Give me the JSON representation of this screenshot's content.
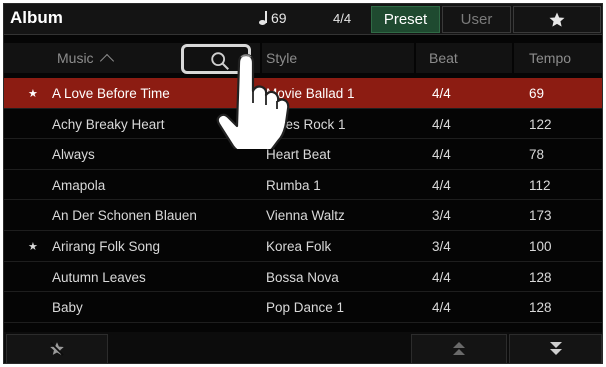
{
  "header": {
    "title": "Album",
    "tempo_value": "69",
    "time_signature": "4/4",
    "tabs": [
      {
        "label": "Preset",
        "active": true
      },
      {
        "label": "User",
        "active": false
      }
    ],
    "favorites_icon": "star-icon"
  },
  "columns": {
    "music": "Music",
    "style": "Style",
    "beat": "Beat",
    "tempo": "Tempo"
  },
  "search_icon": "search-icon",
  "rows": [
    {
      "fav": true,
      "name": "A Love Before Time",
      "style": "Movie Ballad 1",
      "beat": "4/4",
      "tempo": "69",
      "selected": true
    },
    {
      "fav": false,
      "name": "Achy Breaky Heart",
      "style": "Blues Rock 1",
      "beat": "4/4",
      "tempo": "122",
      "selected": false
    },
    {
      "fav": false,
      "name": "Always",
      "style": "Heart Beat",
      "beat": "4/4",
      "tempo": "78",
      "selected": false
    },
    {
      "fav": false,
      "name": "Amapola",
      "style": "Rumba 1",
      "beat": "4/4",
      "tempo": "112",
      "selected": false
    },
    {
      "fav": false,
      "name": "An Der Schonen Blauen",
      "style": "Vienna Waltz",
      "beat": "3/4",
      "tempo": "173",
      "selected": false
    },
    {
      "fav": true,
      "name": "Arirang Folk Song",
      "style": "Korea Folk",
      "beat": "3/4",
      "tempo": "100",
      "selected": false
    },
    {
      "fav": false,
      "name": "Autumn Leaves",
      "style": "Bossa Nova",
      "beat": "4/4",
      "tempo": "128",
      "selected": false
    },
    {
      "fav": false,
      "name": "Baby",
      "style": "Pop Dance 1",
      "beat": "4/4",
      "tempo": "128",
      "selected": false
    }
  ],
  "star_glyph": "★",
  "bottom": {
    "unfavorite_icon": "star-remove-icon",
    "page_up_icon": "page-up-icon",
    "page_down_icon": "page-down-icon"
  },
  "colors": {
    "selected_row": "#8c1c12",
    "active_tab": "#1f4a30"
  }
}
